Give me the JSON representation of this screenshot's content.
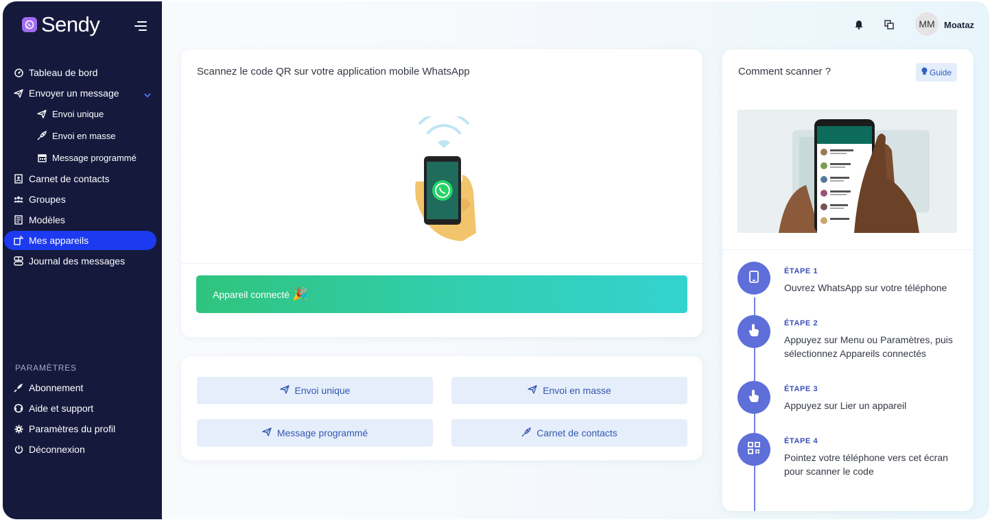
{
  "brand": {
    "name": "Sendy"
  },
  "sidebar": {
    "items": [
      {
        "label": "Tableau de bord",
        "icon": "dashboard-icon"
      },
      {
        "label": "Envoyer un message",
        "icon": "send-icon"
      },
      {
        "label": "Envoi unique",
        "icon": "send-icon"
      },
      {
        "label": "Envoi en masse",
        "icon": "rocket-icon"
      },
      {
        "label": "Message programmé",
        "icon": "calendar-icon"
      },
      {
        "label": "Carnet de contacts",
        "icon": "contacts-icon"
      },
      {
        "label": "Groupes",
        "icon": "groups-icon"
      },
      {
        "label": "Modèles",
        "icon": "templates-icon"
      },
      {
        "label": "Mes appareils",
        "icon": "devices-icon",
        "active": true
      },
      {
        "label": "Journal des messages",
        "icon": "log-icon"
      }
    ],
    "settings_label": "PARAMÈTRES",
    "settings_items": [
      {
        "label": "Abonnement",
        "icon": "subscription-icon"
      },
      {
        "label": "Aide et support",
        "icon": "support-icon"
      },
      {
        "label": "Paramètres du profil",
        "icon": "gear-icon"
      },
      {
        "label": "Déconnexion",
        "icon": "power-icon"
      }
    ]
  },
  "header": {
    "avatar_initials": "MM",
    "username": "Moataz"
  },
  "qr_card": {
    "title": "Scannez le code QR sur votre application mobile WhatsApp",
    "status": "Appareil connecté",
    "status_emoji": "🎉"
  },
  "quick_actions": [
    {
      "label": "Envoi unique"
    },
    {
      "label": "Envoi en masse"
    },
    {
      "label": "Message programmé"
    },
    {
      "label": "Carnet de contacts"
    }
  ],
  "guide_card": {
    "title": "Comment scanner ?",
    "guide_label": "Guide",
    "steps": [
      {
        "label": "ÉTAPE 1",
        "text": "Ouvrez WhatsApp sur votre téléphone"
      },
      {
        "label": "ÉTAPE 2",
        "text_line1": "Appuyez sur Menu ou Paramètres, puis",
        "text_line2": "sélectionnez Appareils connectés"
      },
      {
        "label": "ÉTAPE 3",
        "text": "Appuyez sur Lier un appareil"
      },
      {
        "label": "ÉTAPE 4",
        "text_line1": "Pointez votre téléphone vers cet écran",
        "text_line2": "pour scanner le code"
      }
    ]
  },
  "colors": {
    "sidebar_bg": "#151a3d",
    "active_item": "#1c3bf0",
    "status_gradient_start": "#2fc47d",
    "status_gradient_end": "#33d2cf",
    "step_circle": "#5e6fd9"
  }
}
